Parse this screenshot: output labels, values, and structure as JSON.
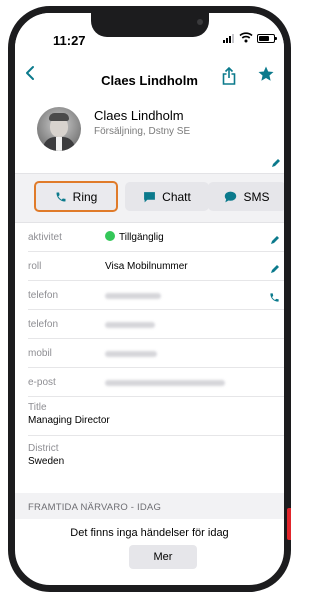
{
  "status_bar": {
    "time": "11:27"
  },
  "navbar": {
    "title": "Claes Lindholm",
    "back_icon": "chevron-left-icon",
    "share_icon": "share-icon",
    "favorite_icon": "star-icon"
  },
  "profile": {
    "name": "Claes Lindholm",
    "subtitle": "Försäljning, Dstny SE"
  },
  "actions": {
    "ring": "Ring",
    "chatt": "Chatt",
    "sms": "SMS"
  },
  "fields": {
    "aktivitet": {
      "label": "aktivitet",
      "value": "Tillgänglig"
    },
    "roll": {
      "label": "roll",
      "value": "Visa Mobilnummer"
    },
    "telefon1": {
      "label": "telefon"
    },
    "telefon2": {
      "label": "telefon"
    },
    "mobil": {
      "label": "mobil"
    },
    "epost": {
      "label": "e-post"
    }
  },
  "details": {
    "title_label": "Title",
    "title_value": "Managing Director",
    "district_label": "District",
    "district_value": "Sweden"
  },
  "presence": {
    "header": "FRAMTIDA NÄRVARO - IDAG",
    "empty": "Det finns inga händelser för idag",
    "more": "Mer"
  },
  "colors": {
    "accent": "#0b7a8c",
    "available": "#34c759",
    "highlight": "#e07b2a"
  }
}
